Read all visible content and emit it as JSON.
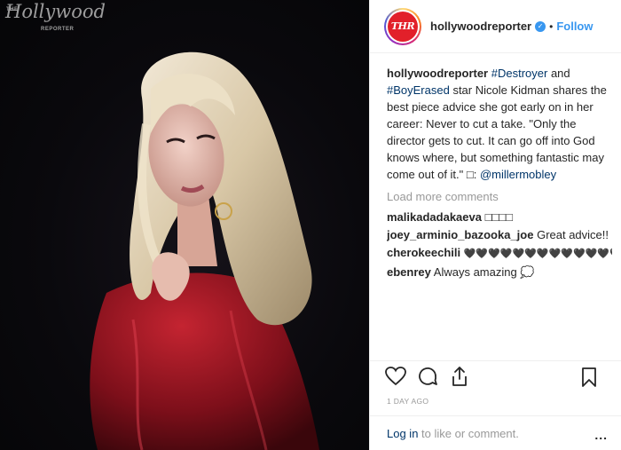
{
  "photo": {
    "watermark_top": "THE",
    "watermark_main": "Hollywood",
    "watermark_bottom": "REPORTER"
  },
  "header": {
    "avatar_text": "THR",
    "username": "hollywoodreporter",
    "verified_icon": "verified-badge",
    "separator": "•",
    "follow_label": "Follow"
  },
  "caption": {
    "username": "hollywoodreporter",
    "tag1": "#Destroyer",
    "and": " and ",
    "tag2": "#BoyErased",
    "text": " star Nicole Kidman shares the best piece advice she got early on in her career: Never to cut a take. \"Only the director gets to cut. It can go off into God knows where, but something fantastic may come out of it.\" □: ",
    "mention": "@millermobley"
  },
  "load_more": "Load more comments",
  "comments": [
    {
      "user": "malikadadakaeva",
      "text": "□□□□"
    },
    {
      "user": "joey_arminio_bazooka_joe",
      "text": "Great advice!!"
    },
    {
      "user": "cherokeechili",
      "text": "🖤🖤🖤🖤🖤🖤🖤🖤🖤🖤🖤🖤🖤"
    },
    {
      "user": "ebenrey",
      "text": "Always amazing 💭"
    }
  ],
  "actions": {
    "like_icon": "heart-icon",
    "comment_icon": "comment-icon",
    "share_icon": "share-icon",
    "save_icon": "bookmark-icon"
  },
  "date": "1 DAY AGO",
  "footer": {
    "login": "Log in",
    "rest": " to like or comment.",
    "more": "..."
  },
  "colors": {
    "link": "#003569",
    "accent": "#3897f0",
    "muted": "#999999",
    "brand_red": "#e2202a"
  }
}
